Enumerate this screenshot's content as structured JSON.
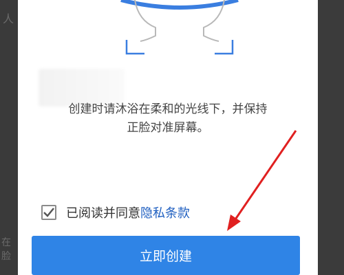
{
  "left_edge": {
    "top_glyph": "人",
    "side_glyph_1": "在",
    "side_glyph_2": "脸"
  },
  "instruction": {
    "line1": "创建时请沐浴在柔和的光线下，并保持",
    "line2": "正脸对准屏幕。"
  },
  "agreement": {
    "checked": true,
    "text": "已阅读并同意",
    "link_text": "隐私条款"
  },
  "create_button": {
    "label": "立即创建"
  },
  "colors": {
    "accent_blue": "#2f84e6",
    "link_blue": "#1f5fc0",
    "frame_blue": "#3a7ee0",
    "arrow_red": "#e02020"
  },
  "icons": [
    "face-outline-icon",
    "checkmark-icon",
    "annotation-arrow-icon"
  ]
}
